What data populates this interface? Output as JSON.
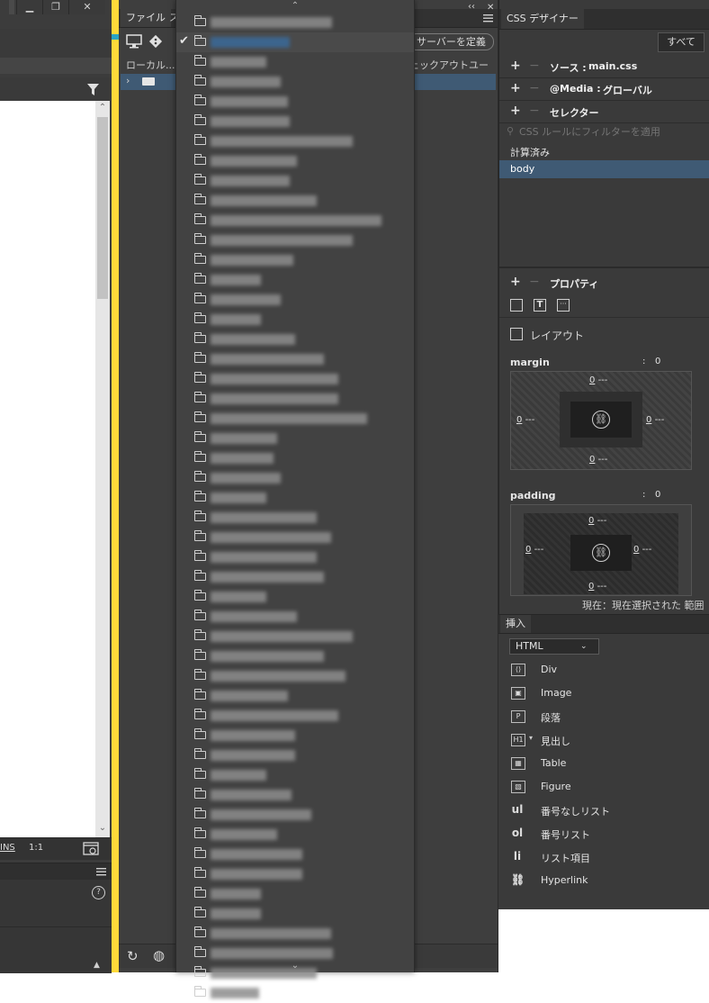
{
  "left_panel": {
    "status": {
      "mode": "INS",
      "ratio": "1:1"
    }
  },
  "files_panel": {
    "tab_files": "ファイル",
    "tab_second_fragment": "ス",
    "define_server": "サーバーを定義",
    "col_local": "ローカル...",
    "col_checkout_user": "ェックアウトユーザー"
  },
  "folder_dropdown": {
    "checked_index": 1
  },
  "css_designer": {
    "tab": "CSS デザイナー",
    "all_button": "すべて",
    "sources_label": "ソース :",
    "sources_value": "main.css",
    "media_label": "@Media :",
    "media_value": "グローバル",
    "selectors_label": "セレクター",
    "filter_placeholder": "CSS ルールにフィルターを適用",
    "computed": "計算済み",
    "selected_selector": "body",
    "properties_label": "プロパティ",
    "layout_label": "レイアウト",
    "margin_label": "margin",
    "margin_value": "0",
    "margin_top": "0",
    "margin_top_dash": "---",
    "margin_left": "0",
    "margin_left_dash": "---",
    "margin_right": "0",
    "margin_right_dash": "---",
    "margin_bottom": "0",
    "margin_bottom_dash": "---",
    "padding_label": "padding",
    "padding_value": "0",
    "padding_top": "0",
    "padding_top_dash": "---",
    "padding_left": "0",
    "padding_left_dash": "---",
    "padding_right": "0",
    "padding_right_dash": "---",
    "padding_bottom": "0",
    "padding_bottom_dash": "---",
    "current_info": "現在：現在選択された 範囲"
  },
  "insert_panel": {
    "tab": "挿入",
    "category": "HTML",
    "items": [
      "Div",
      "Image",
      "段落",
      "見出し",
      "Table",
      "Figure",
      "番号なしリスト",
      "番号リスト",
      "リスト項目",
      "Hyperlink"
    ]
  }
}
